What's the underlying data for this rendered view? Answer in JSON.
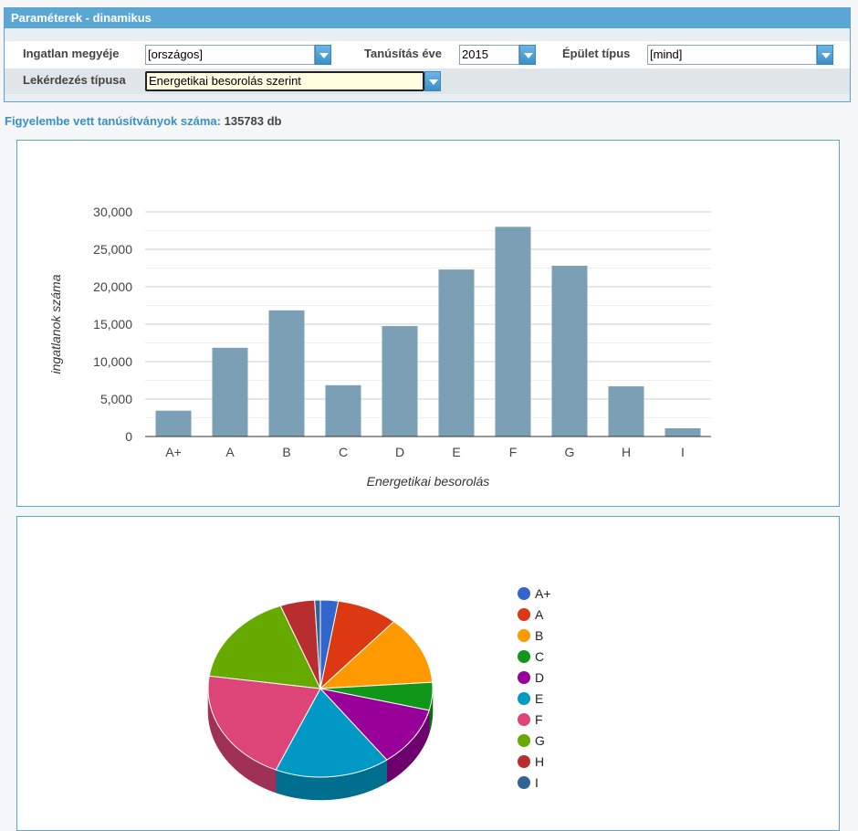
{
  "panel": {
    "title": "Paraméterek - dinamikus"
  },
  "filters": {
    "county_label": "Ingatlan megyéje",
    "county_value": "[országos]",
    "year_label": "Tanúsítás éve",
    "year_value": "2015",
    "building_label": "Épület típus",
    "building_value": "[mind]",
    "query_label": "Lekérdezés típusa",
    "query_value": "Energetikai besorolás szerint"
  },
  "summary": {
    "label": "Figyelembe vett tanúsítványok száma:",
    "value": "135783 db"
  },
  "colors": {
    "bar": "#7b9fb5",
    "slices": [
      "#3366cc",
      "#dc3912",
      "#ff9900",
      "#109618",
      "#990099",
      "#0099c6",
      "#dd4477",
      "#66aa00",
      "#b82e2e",
      "#316395"
    ]
  },
  "chart_data": [
    {
      "type": "bar",
      "categories": [
        "A+",
        "A",
        "B",
        "C",
        "D",
        "E",
        "F",
        "G",
        "H",
        "I"
      ],
      "values": [
        3450,
        11850,
        16850,
        6850,
        14750,
        22300,
        28000,
        22800,
        6700,
        1100
      ],
      "title": "",
      "xlabel": "Energetikai besorolás",
      "ylabel": "ingatlanok száma",
      "ylim": [
        0,
        30000
      ],
      "yticks": [
        "0",
        "5,000",
        "10,000",
        "15,000",
        "20,000",
        "25,000",
        "30,000"
      ],
      "grid": true
    },
    {
      "type": "pie",
      "labels": [
        "A+",
        "A",
        "B",
        "C",
        "D",
        "E",
        "F",
        "G",
        "H",
        "I"
      ],
      "values": [
        3450,
        11850,
        16850,
        6850,
        14750,
        22300,
        28000,
        22800,
        6700,
        1100
      ],
      "legend": "right",
      "style": "3d"
    }
  ]
}
